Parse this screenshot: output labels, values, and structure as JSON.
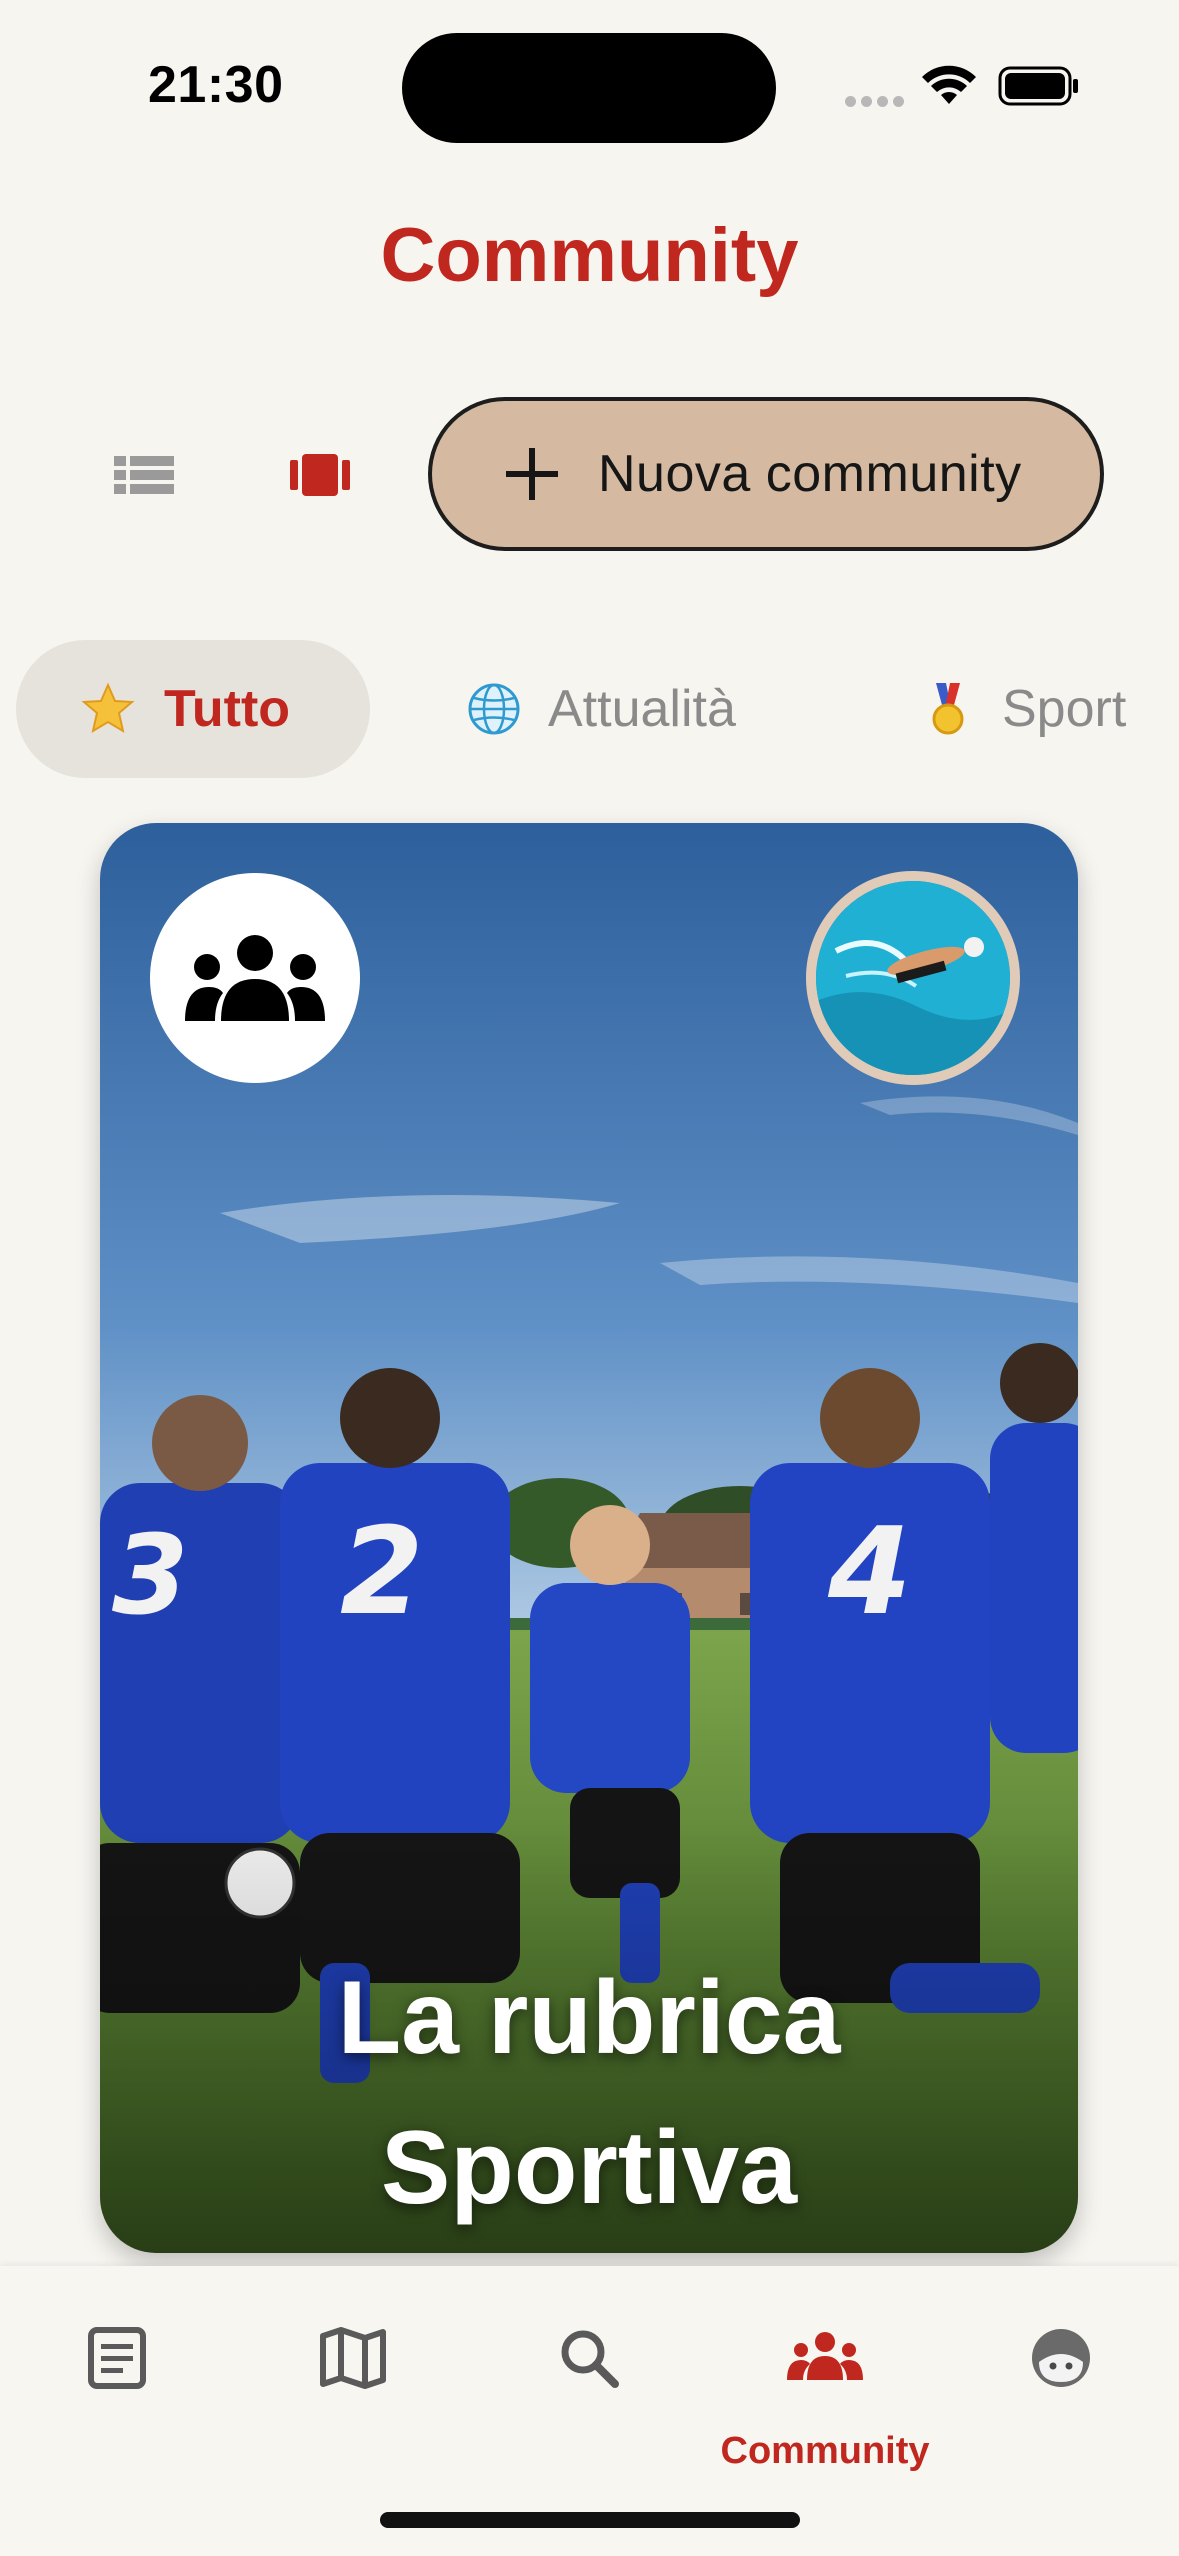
{
  "status_bar": {
    "time": "21:30"
  },
  "header": {
    "title": "Community"
  },
  "toolbar": {
    "view_list_icon": "list-view-icon",
    "view_card_icon": "card-view-icon",
    "new_community_label": "Nuova community"
  },
  "categories": [
    {
      "emoji": "star",
      "label": "Tutto",
      "selected": true
    },
    {
      "emoji": "globe",
      "label": "Attualità",
      "selected": false
    },
    {
      "emoji": "medal",
      "label": "Sport",
      "selected": false
    }
  ],
  "community_card": {
    "title_line1": "La rubrica",
    "title_line2": "Sportiva",
    "group_icon": "group-icon",
    "avatar": "swimmer-avatar"
  },
  "tab_bar": {
    "items": [
      {
        "icon": "article-icon",
        "label": "",
        "active": false
      },
      {
        "icon": "map-icon",
        "label": "",
        "active": false
      },
      {
        "icon": "search-icon",
        "label": "",
        "active": false
      },
      {
        "icon": "community-icon",
        "label": "Community",
        "active": true
      },
      {
        "icon": "profile-icon",
        "label": "",
        "active": false
      }
    ]
  },
  "colors": {
    "accent": "#c0281f",
    "background": "#f7f5f0",
    "button_fill": "#d5b9a1",
    "chip_active": "#e6e3dd",
    "muted": "#8a8a8a"
  }
}
